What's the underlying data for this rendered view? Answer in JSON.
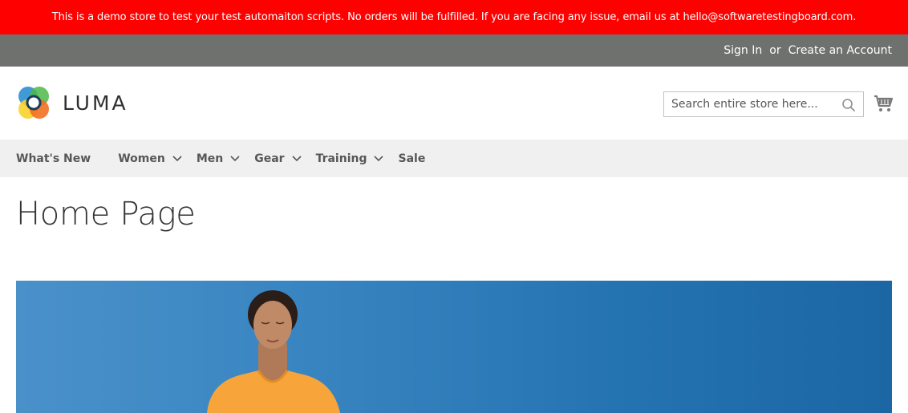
{
  "notice": {
    "text": "This is a demo store to test your test automaiton scripts. No orders will be fulfilled. If you are facing any issue, email us at hello@softwaretestingboard.com."
  },
  "header_links": {
    "sign_in": "Sign In",
    "or": "or",
    "create_account": "Create an Account"
  },
  "logo": {
    "text": "LUMA"
  },
  "search": {
    "placeholder": "Search entire store here...",
    "icon": "search-icon"
  },
  "cart": {
    "icon": "cart-icon"
  },
  "nav": {
    "items": [
      {
        "label": "What's New",
        "has_dropdown": false
      },
      {
        "label": "Women",
        "has_dropdown": true
      },
      {
        "label": "Men",
        "has_dropdown": true
      },
      {
        "label": "Gear",
        "has_dropdown": true
      },
      {
        "label": "Training",
        "has_dropdown": true
      },
      {
        "label": "Sale",
        "has_dropdown": false
      }
    ]
  },
  "page": {
    "title": "Home Page"
  },
  "colors": {
    "notice_bg": "#ff0000",
    "panel_bg": "#6e716e",
    "nav_bg": "#f0f0f0",
    "hero_sky": "#2f7bb8",
    "shirt": "#f7a43b"
  }
}
